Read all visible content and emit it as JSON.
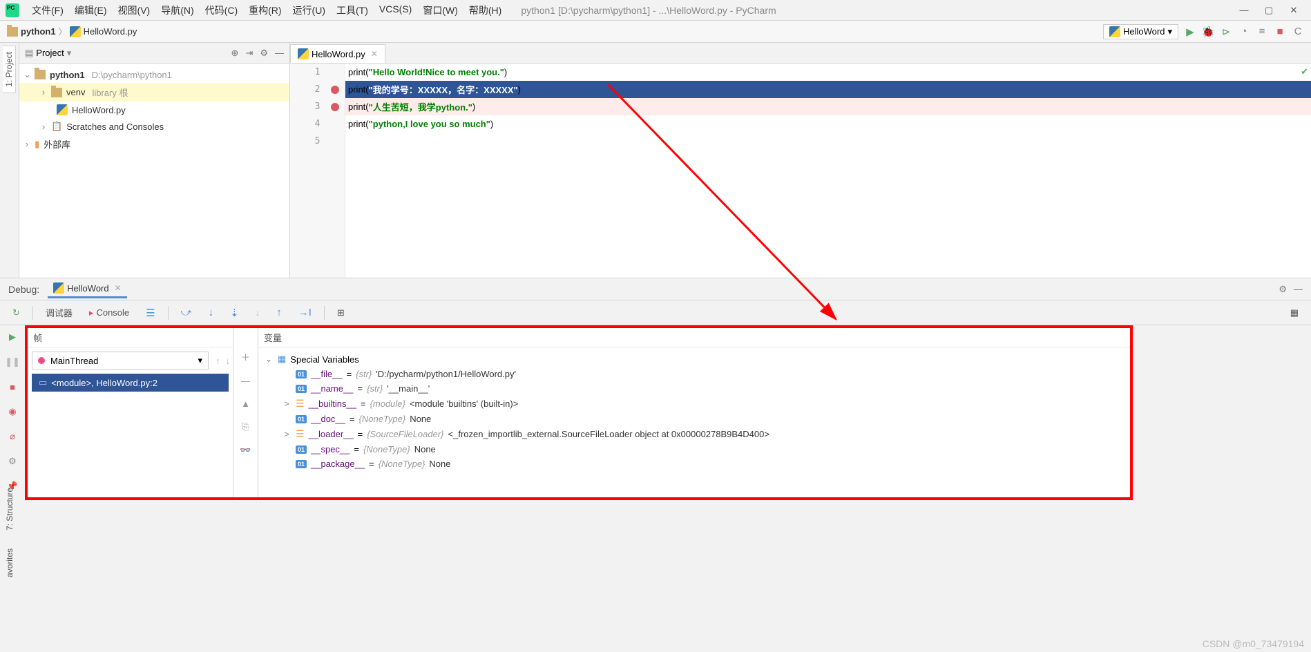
{
  "menus": [
    "文件(F)",
    "编辑(E)",
    "视图(V)",
    "导航(N)",
    "代码(C)",
    "重构(R)",
    "运行(U)",
    "工具(T)",
    "VCS(S)",
    "窗口(W)",
    "帮助(H)"
  ],
  "title_path": "python1 [D:\\pycharm\\python1] - ...\\HelloWord.py - PyCharm",
  "breadcrumb": {
    "project": "python1",
    "file": "HelloWord.py"
  },
  "run_config": "HelloWord",
  "sidebar": {
    "title": "Project",
    "project": {
      "name": "python1",
      "path": "D:\\pycharm\\python1"
    },
    "venv": {
      "name": "venv",
      "hint": "library 根"
    },
    "file": "HelloWord.py",
    "scratches": "Scratches and Consoles",
    "ext_lib": "外部库"
  },
  "vtabs": {
    "project": "1: Project",
    "structure": "7: Structure",
    "favorites": "avorites"
  },
  "editor": {
    "tab": "HelloWord.py",
    "lines": [
      {
        "n": "1",
        "code": [
          {
            "t": "kw",
            "v": "print("
          },
          {
            "t": "str",
            "v": "\"Hello World!Nice to meet you.\""
          },
          {
            "t": "kw",
            "v": ")"
          }
        ],
        "bp": false,
        "hl": false
      },
      {
        "n": "2",
        "code": [
          {
            "t": "kw",
            "v": "print("
          },
          {
            "t": "str",
            "v": "\"我的学号：XXXXX，名字：XXXXX\""
          },
          {
            "t": "kw",
            "v": ")"
          }
        ],
        "bp": true,
        "hl": true
      },
      {
        "n": "3",
        "code": [
          {
            "t": "kw",
            "v": "print("
          },
          {
            "t": "str",
            "v": "\"人生苦短，我学python.\""
          },
          {
            "t": "kw",
            "v": ")"
          }
        ],
        "bp": true,
        "hl": false,
        "bpbg": true
      },
      {
        "n": "4",
        "code": [
          {
            "t": "kw",
            "v": "print("
          },
          {
            "t": "str",
            "v": "\"python,I love you so much\""
          },
          {
            "t": "kw",
            "v": ")"
          }
        ],
        "bp": false,
        "hl": false
      },
      {
        "n": "5",
        "code": [],
        "bp": false,
        "hl": false
      }
    ]
  },
  "debug": {
    "title": "Debug:",
    "tab": "HelloWord",
    "subtabs": {
      "debugger": "调试器",
      "console": "Console"
    },
    "frames_label": "帧",
    "vars_label": "变量",
    "thread": "MainThread",
    "frame": "<module>, HelloWord.py:2",
    "special_vars_label": "Special Variables",
    "vars": [
      {
        "badge": "01",
        "name": "__file__",
        "type": "{str}",
        "val": "'D:/pycharm/python1/HelloWord.py'",
        "arrow": ""
      },
      {
        "badge": "01",
        "name": "__name__",
        "type": "{str}",
        "val": "'__main__'",
        "arrow": ""
      },
      {
        "badge": "lines",
        "name": "__builtins__",
        "type": "{module}",
        "val": "<module 'builtins' (built-in)>",
        "arrow": ">"
      },
      {
        "badge": "01",
        "name": "__doc__",
        "type": "{NoneType}",
        "val": "None",
        "arrow": ""
      },
      {
        "badge": "lines",
        "name": "__loader__",
        "type": "{SourceFileLoader}",
        "val": "<_frozen_importlib_external.SourceFileLoader object at 0x00000278B9B4D400>",
        "arrow": ">"
      },
      {
        "badge": "01",
        "name": "__spec__",
        "type": "{NoneType}",
        "val": "None",
        "arrow": ""
      },
      {
        "badge": "01",
        "name": "__package__",
        "type": "{NoneType}",
        "val": "None",
        "arrow": ""
      }
    ]
  },
  "watermark": "CSDN @m0_73479194"
}
